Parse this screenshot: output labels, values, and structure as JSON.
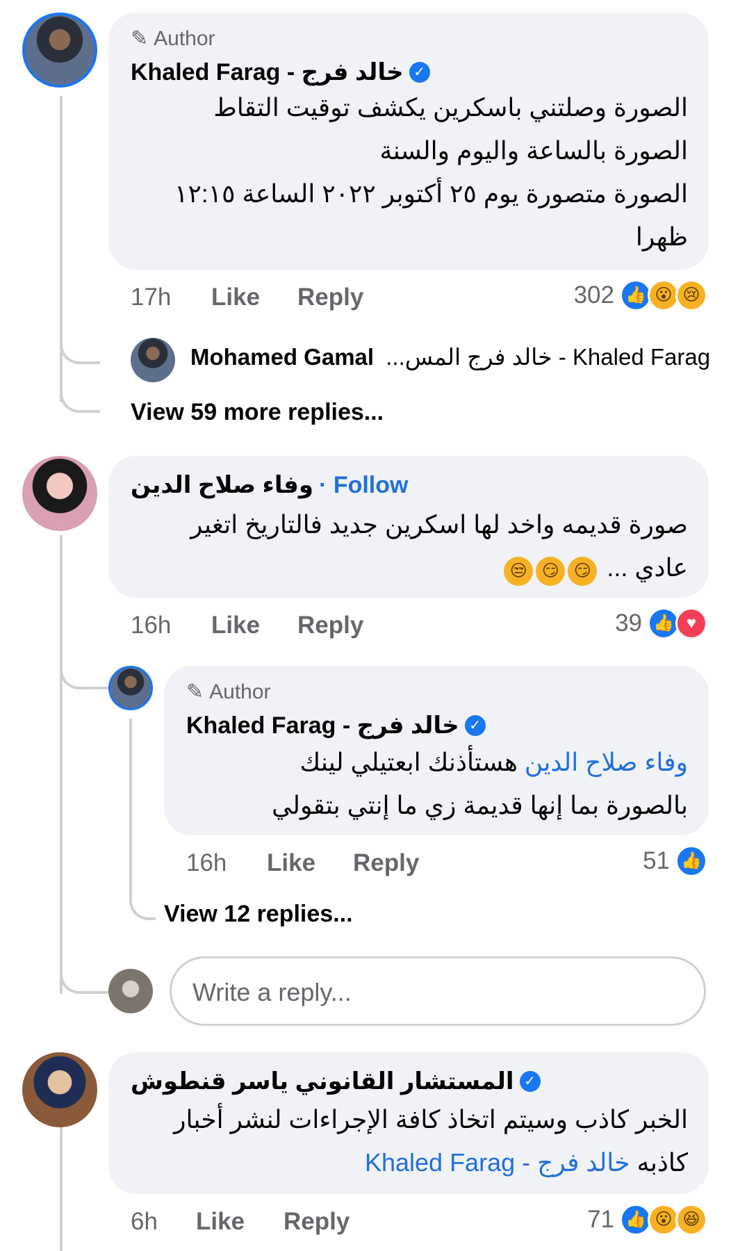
{
  "c1": {
    "author_tag": "Author",
    "name": "Khaled Farag - خالد فرج",
    "lines": [
      "الصورة وصلتني باسكرين يكشف توقيت التقاط",
      "الصورة بالساعة واليوم والسنة",
      "الصورة متصورة يوم ٢٥ أكتوبر ٢٠٢٢ الساعة ١٢:١٥",
      "ظهرا"
    ],
    "time": "17h",
    "like": "Like",
    "reply": "Reply",
    "count": "302",
    "preview_name": "Mohamed Gamal",
    "preview_text": "Khaled Farag - خالد فرج المس...",
    "view_more": "View 59 more replies..."
  },
  "c2": {
    "name": "وفاء صلاح الدين",
    "follow": "· Follow",
    "lines": [
      "صورة قديمه واخد لها اسكرين جديد فالتاريخ اتغير"
    ],
    "line2_text": "عادي ...",
    "time": "16h",
    "like": "Like",
    "reply": "Reply",
    "count": "39"
  },
  "c3": {
    "author_tag": "Author",
    "name": "Khaled Farag - خالد فرج",
    "mention": "وفاء صلاح الدين",
    "line1_rest": " هستأذنك ابعتيلي لينك",
    "line2": "بالصورة بما إنها قديمة زي ما إنتي بتقولي",
    "time": "16h",
    "like": "Like",
    "reply": "Reply",
    "count": "51",
    "view_more": "View 12 replies..."
  },
  "reply_box": {
    "placeholder": "Write a reply..."
  },
  "c4": {
    "name": "المستشار القانوني  ياسر قنطوش",
    "line1": "الخبر كاذب وسيتم اتخاذ كافة الإجراءات لنشر أخبار",
    "line2_word": "كاذبه",
    "mention": "Khaled Farag - خالد فرج",
    "time": "6h",
    "like": "Like",
    "reply": "Reply",
    "count": "71"
  }
}
